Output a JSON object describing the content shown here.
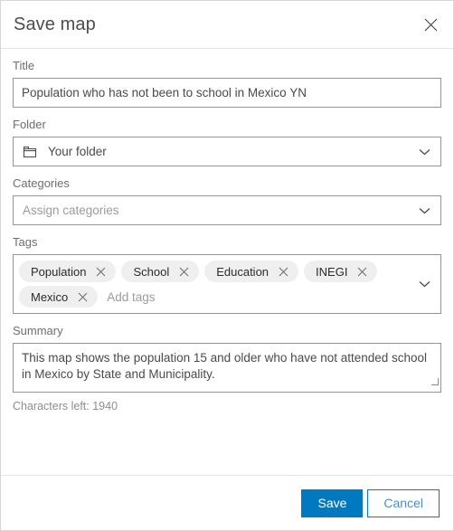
{
  "dialog": {
    "title": "Save map",
    "close_icon": "close-icon"
  },
  "form": {
    "title_field": {
      "label": "Title",
      "value": "Population who has not been to school in Mexico YN",
      "placeholder": ""
    },
    "folder_field": {
      "label": "Folder",
      "value": "Your folder",
      "icon": "folder-icon",
      "chevron": "chevron-down-icon"
    },
    "categories_field": {
      "label": "Categories",
      "value": "",
      "placeholder": "Assign categories",
      "chevron": "chevron-down-icon"
    },
    "tags_field": {
      "label": "Tags",
      "placeholder": "Add tags",
      "chevron": "chevron-down-icon",
      "tags": [
        {
          "label": "Population",
          "remove_icon": "close-icon"
        },
        {
          "label": "School",
          "remove_icon": "close-icon"
        },
        {
          "label": "Education",
          "remove_icon": "close-icon"
        },
        {
          "label": "INEGI",
          "remove_icon": "close-icon"
        },
        {
          "label": "Mexico",
          "remove_icon": "close-icon"
        }
      ]
    },
    "summary_field": {
      "label": "Summary",
      "value": "This map shows the population 15 and older who have not attended school in Mexico by State and Municipality.",
      "characters_left": "Characters left: 1940"
    }
  },
  "footer": {
    "save_label": "Save",
    "cancel_label": "Cancel"
  },
  "colors": {
    "accent": "#0079c1",
    "cancel_text": "#4b8ec7",
    "border": "#949494",
    "label": "#6e6e6e",
    "tag_background": "#efefef"
  }
}
